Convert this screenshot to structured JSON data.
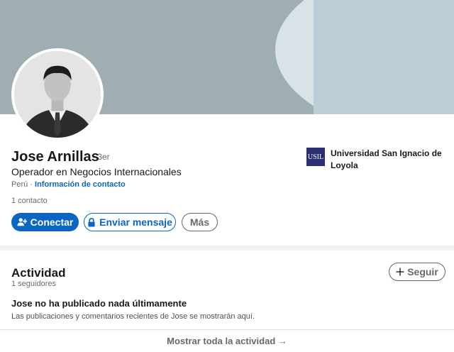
{
  "profile": {
    "name": "Jose Arnillas",
    "degree": "· 3er",
    "headline": "Operador en Negocios Internacionales",
    "location": "Perú",
    "separator": " · ",
    "contact_info_label": "Información de contacto",
    "connections": "1 contacto",
    "school": {
      "logo_text": "USIL",
      "name": "Universidad San Ignacio de Loyola"
    }
  },
  "actions": {
    "connect_label": "Conectar",
    "message_label": "Enviar mensaje",
    "more_label": "Más"
  },
  "activity": {
    "title": "Actividad",
    "followers": "1 seguidores",
    "follow_label": "Seguir",
    "empty_title": "Jose no ha publicado nada últimamente",
    "empty_desc": "Las publicaciones y comentarios recientes de Jose se mostrarán aquí.",
    "show_all_label": "Mostrar toda la actividad →"
  },
  "colors": {
    "primary": "#0a66c2",
    "banner": "#9eaeb2",
    "school_logo": "#2a2f73"
  }
}
